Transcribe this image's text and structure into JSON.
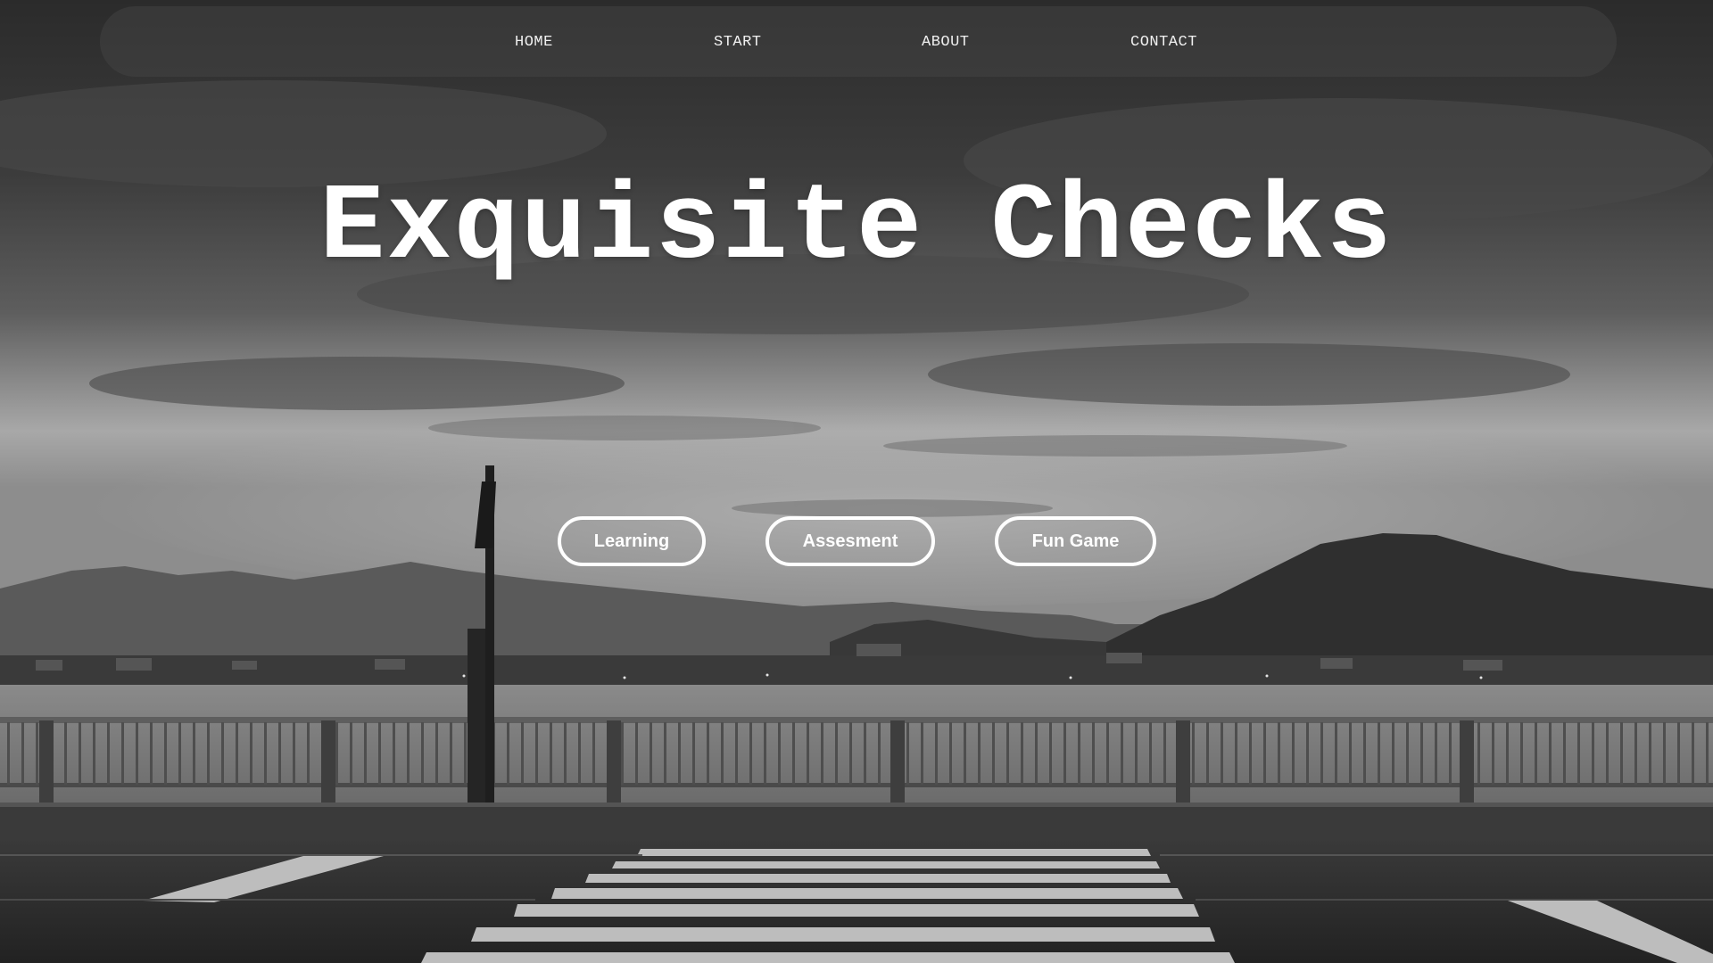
{
  "nav": {
    "items": [
      {
        "label": "HOME"
      },
      {
        "label": "START"
      },
      {
        "label": "ABOUT"
      },
      {
        "label": "CONTACT"
      }
    ]
  },
  "hero": {
    "title": "Exquisite Checks",
    "buttons": [
      {
        "label": "Learning"
      },
      {
        "label": "Assesment"
      },
      {
        "label": "Fun Game"
      }
    ]
  },
  "colors": {
    "text": "#ffffff",
    "nav_text": "#f0f0f0",
    "navbar_bg": "rgba(70,70,70,0.45)"
  }
}
